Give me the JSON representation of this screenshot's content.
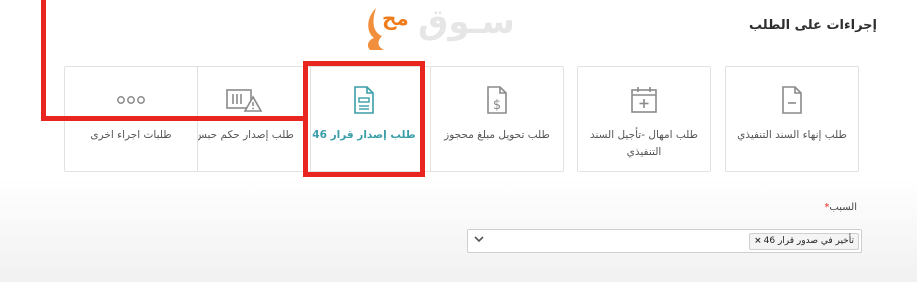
{
  "section": {
    "title": "إجراءات على الطلب"
  },
  "watermark": {
    "text": "سـوق",
    "mark": "مح"
  },
  "cards": [
    {
      "label": "طلب إنهاء السند التنفيذي",
      "icon": "document-minus-icon"
    },
    {
      "label": "طلب امهال -تأجيل السند التنفيذي",
      "icon": "calendar-plus-icon"
    },
    {
      "label": "طلب تحويل مبلغ محجوز",
      "icon": "document-dollar-icon"
    },
    {
      "label": "طلب إصدار قرار 46",
      "icon": "document-lines-icon"
    },
    {
      "label": "طلب إصدار حكم حبس",
      "icon": "prison-warning-icon"
    },
    {
      "label": "طلبات اجراء اخرى",
      "icon": "ellipsis-icon"
    }
  ],
  "reason": {
    "label": "السبب",
    "required_mark": "*",
    "selected": "تأخير في صدور قرار 46",
    "remove_glyph": "×"
  },
  "colors": {
    "accent": "#3a9ea8",
    "highlight": "#e8251e"
  }
}
